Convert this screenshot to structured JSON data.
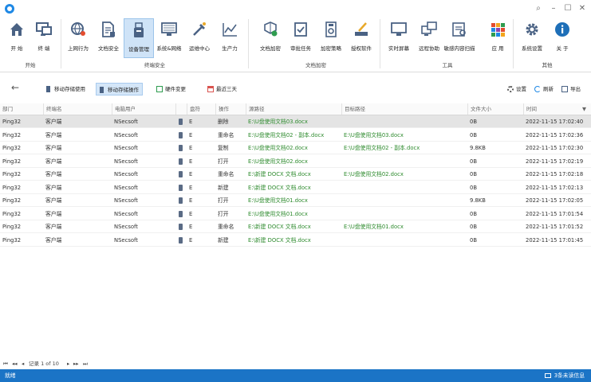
{
  "window": {
    "search_glyph": "⌕",
    "minimize_glyph": "–",
    "maximize_glyph": "☐",
    "close_glyph": "✕"
  },
  "ribbon": {
    "groups": [
      {
        "label": "开始",
        "buttons": [
          {
            "label": "开 始",
            "icon": "home-icon"
          },
          {
            "label": "终 端",
            "icon": "terminal-icon"
          }
        ]
      },
      {
        "label": "终端安全",
        "buttons": [
          {
            "label": "上网行为",
            "icon": "globe-icon"
          },
          {
            "label": "文档安全",
            "icon": "document-icon"
          },
          {
            "label": "设备管理",
            "icon": "usb-icon"
          },
          {
            "label": "系统&网络",
            "icon": "network-icon"
          },
          {
            "label": "运维中心",
            "icon": "tools-icon"
          },
          {
            "label": "生产力",
            "icon": "chart-icon"
          }
        ]
      },
      {
        "label": "文档加密",
        "buttons": [
          {
            "label": "文档加密",
            "icon": "encrypt-doc-icon"
          },
          {
            "label": "审批任务",
            "icon": "approval-icon"
          },
          {
            "label": "加密策略",
            "icon": "lock-icon"
          },
          {
            "label": "授权软件",
            "icon": "license-icon"
          }
        ]
      },
      {
        "label": "工具",
        "buttons": [
          {
            "label": "实时屏幕",
            "icon": "monitor-icon"
          },
          {
            "label": "远程协助",
            "icon": "remote-icon"
          },
          {
            "label": "敏感内容扫描",
            "icon": "scan-icon"
          },
          {
            "label": "应 用",
            "icon": "apps-icon"
          }
        ]
      },
      {
        "label": "其他",
        "buttons": [
          {
            "label": "系统设置",
            "icon": "gear-icon"
          },
          {
            "label": "关 于",
            "icon": "info-icon"
          }
        ]
      }
    ]
  },
  "subtoolbar": {
    "back_glyph": "←",
    "tabs": [
      {
        "label": "移动存储使用"
      },
      {
        "label": "移动存储操作"
      },
      {
        "label": "硬件变更"
      },
      {
        "label": "最近三天"
      }
    ],
    "settings_label": "设置",
    "refresh_label": "刷新",
    "export_label": "导出"
  },
  "table": {
    "columns": [
      "部门",
      "终端名",
      "电脑用户",
      "",
      "盘符",
      "操作",
      "源路径",
      "目标路径",
      "文件大小",
      "时间"
    ],
    "sort_glyph": "▼",
    "rows": [
      {
        "dept": "Ping32",
        "terminal": "客户端",
        "user": "NSecsoft",
        "drive": "E",
        "op": "删除",
        "src": "E:\\U盘使用文档03.docx",
        "dst": "",
        "size": "0B",
        "time": "2022-11-15 17:02:40"
      },
      {
        "dept": "Ping32",
        "terminal": "客户端",
        "user": "NSecsoft",
        "drive": "E",
        "op": "重命名",
        "src": "E:\\U盘使用文档02 - 副本.docx",
        "dst": "E:\\U盘使用文档03.docx",
        "size": "0B",
        "time": "2022-11-15 17:02:36"
      },
      {
        "dept": "Ping32",
        "terminal": "客户端",
        "user": "NSecsoft",
        "drive": "E",
        "op": "复制",
        "src": "E:\\U盘使用文档02.docx",
        "dst": "E:\\U盘使用文档02 - 副本.docx",
        "size": "9.8KB",
        "time": "2022-11-15 17:02:30"
      },
      {
        "dept": "Ping32",
        "terminal": "客户端",
        "user": "NSecsoft",
        "drive": "E",
        "op": "打开",
        "src": "E:\\U盘使用文档02.docx",
        "dst": "",
        "size": "0B",
        "time": "2022-11-15 17:02:19"
      },
      {
        "dept": "Ping32",
        "terminal": "客户端",
        "user": "NSecsoft",
        "drive": "E",
        "op": "重命名",
        "src": "E:\\新建 DOCX 文档.docx",
        "dst": "E:\\U盘使用文档02.docx",
        "size": "0B",
        "time": "2022-11-15 17:02:18"
      },
      {
        "dept": "Ping32",
        "terminal": "客户端",
        "user": "NSecsoft",
        "drive": "E",
        "op": "新建",
        "src": "E:\\新建 DOCX 文档.docx",
        "dst": "",
        "size": "0B",
        "time": "2022-11-15 17:02:13"
      },
      {
        "dept": "Ping32",
        "terminal": "客户端",
        "user": "NSecsoft",
        "drive": "E",
        "op": "打开",
        "src": "E:\\U盘使用文档01.docx",
        "dst": "",
        "size": "9.8KB",
        "time": "2022-11-15 17:02:05"
      },
      {
        "dept": "Ping32",
        "terminal": "客户端",
        "user": "NSecsoft",
        "drive": "E",
        "op": "打开",
        "src": "E:\\U盘使用文档01.docx",
        "dst": "",
        "size": "0B",
        "time": "2022-11-15 17:01:54"
      },
      {
        "dept": "Ping32",
        "terminal": "客户端",
        "user": "NSecsoft",
        "drive": "E",
        "op": "重命名",
        "src": "E:\\新建 DOCX 文档.docx",
        "dst": "E:\\U盘使用文档01.docx",
        "size": "0B",
        "time": "2022-11-15 17:01:52"
      },
      {
        "dept": "Ping32",
        "terminal": "客户端",
        "user": "NSecsoft",
        "drive": "E",
        "op": "新建",
        "src": "E:\\新建 DOCX 文档.docx",
        "dst": "",
        "size": "0B",
        "time": "2022-11-15 17:01:45"
      }
    ]
  },
  "pager": {
    "first": "⏮",
    "prev": "◂◂",
    "prev1": "◂",
    "record_text": "记录 1 of 10",
    "next": "▸",
    "next2": "▸▸",
    "last": "⏭"
  },
  "status": {
    "left": "就绪",
    "right": "3条未读信息"
  }
}
